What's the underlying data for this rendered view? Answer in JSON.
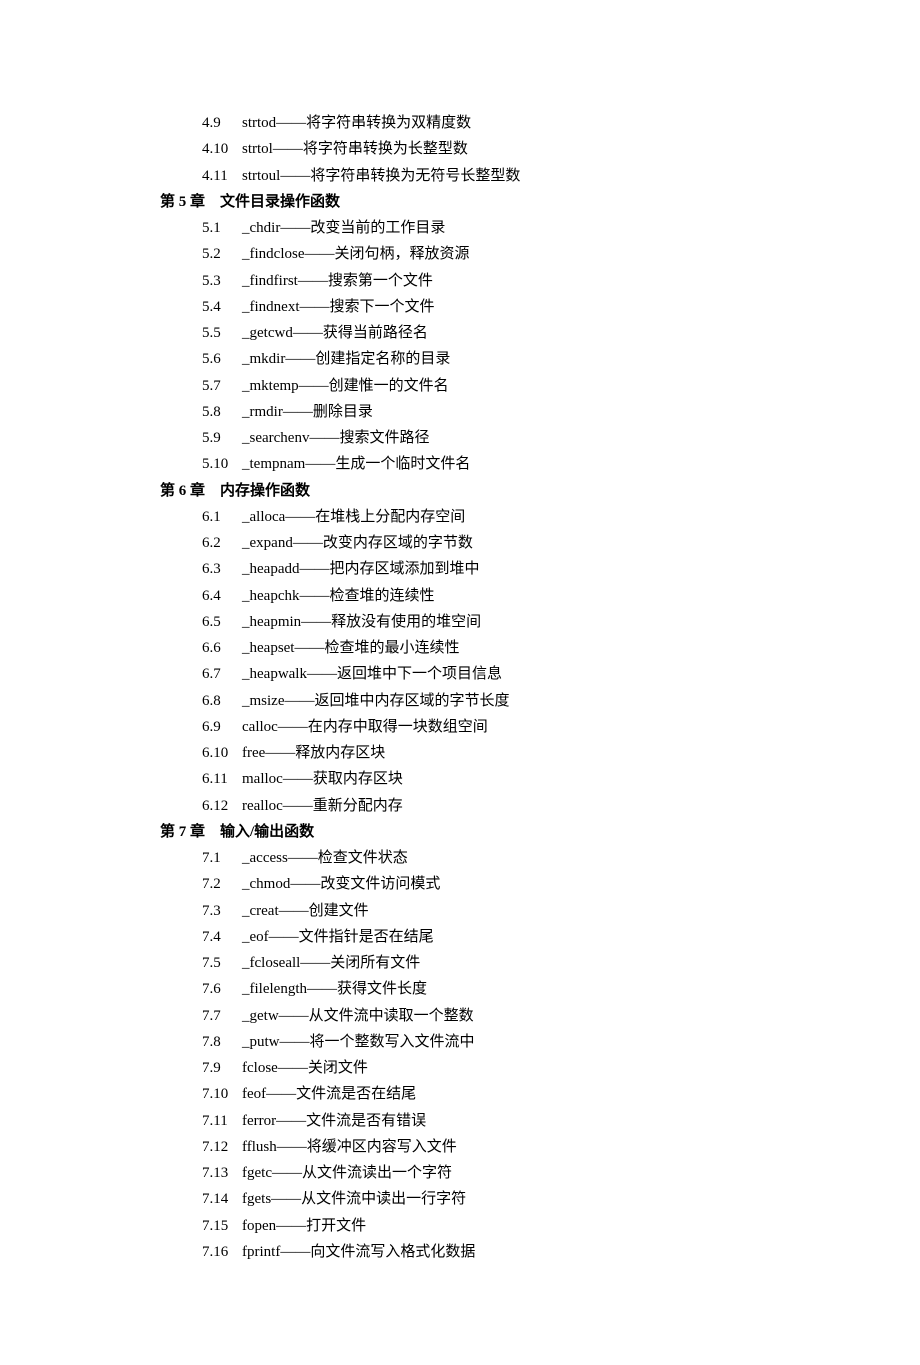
{
  "sections": [
    {
      "heading": null,
      "items": [
        {
          "num": "4.9",
          "text": "strtod——将字符串转换为双精度数"
        },
        {
          "num": "4.10",
          "text": "strtol——将字符串转换为长整型数"
        },
        {
          "num": "4.11",
          "text": "strtoul——将字符串转换为无符号长整型数"
        }
      ]
    },
    {
      "heading": "第 5 章　文件目录操作函数",
      "items": [
        {
          "num": "5.1",
          "text": "_chdir——改变当前的工作目录"
        },
        {
          "num": "5.2",
          "text": "_findclose——关闭句柄，释放资源"
        },
        {
          "num": "5.3",
          "text": "_findfirst——搜索第一个文件"
        },
        {
          "num": "5.4",
          "text": "_findnext——搜索下一个文件"
        },
        {
          "num": "5.5",
          "text": "_getcwd——获得当前路径名"
        },
        {
          "num": "5.6",
          "text": "_mkdir——创建指定名称的目录"
        },
        {
          "num": "5.7",
          "text": "_mktemp——创建惟一的文件名"
        },
        {
          "num": "5.8",
          "text": "_rmdir——删除目录"
        },
        {
          "num": "5.9",
          "text": "_searchenv——搜索文件路径"
        },
        {
          "num": "5.10",
          "text": "_tempnam——生成一个临时文件名"
        }
      ]
    },
    {
      "heading": "第 6 章　内存操作函数",
      "items": [
        {
          "num": "6.1",
          "text": "_alloca——在堆栈上分配内存空间"
        },
        {
          "num": "6.2",
          "text": "_expand——改变内存区域的字节数"
        },
        {
          "num": "6.3",
          "text": "_heapadd——把内存区域添加到堆中"
        },
        {
          "num": "6.4",
          "text": "_heapchk——检查堆的连续性"
        },
        {
          "num": "6.5",
          "text": "_heapmin——释放没有使用的堆空间"
        },
        {
          "num": "6.6",
          "text": "_heapset——检查堆的最小连续性"
        },
        {
          "num": "6.7",
          "text": "_heapwalk——返回堆中下一个项目信息"
        },
        {
          "num": "6.8",
          "text": "_msize——返回堆中内存区域的字节长度"
        },
        {
          "num": "6.9",
          "text": "calloc——在内存中取得一块数组空间"
        },
        {
          "num": "6.10",
          "text": "free——释放内存区块"
        },
        {
          "num": "6.11",
          "text": "malloc——获取内存区块"
        },
        {
          "num": "6.12",
          "text": "realloc——重新分配内存"
        }
      ]
    },
    {
      "heading": "第 7 章　输入/输出函数",
      "items": [
        {
          "num": "7.1",
          "text": "_access——检查文件状态"
        },
        {
          "num": "7.2",
          "text": "_chmod——改变文件访问模式"
        },
        {
          "num": "7.3",
          "text": "_creat——创建文件"
        },
        {
          "num": "7.4",
          "text": "_eof——文件指针是否在结尾"
        },
        {
          "num": "7.5",
          "text": "_fcloseall——关闭所有文件"
        },
        {
          "num": "7.6",
          "text": "_filelength——获得文件长度"
        },
        {
          "num": "7.7",
          "text": "_getw——从文件流中读取一个整数"
        },
        {
          "num": "7.8",
          "text": "_putw——将一个整数写入文件流中"
        },
        {
          "num": "7.9",
          "text": "fclose——关闭文件"
        },
        {
          "num": "7.10",
          "text": "feof——文件流是否在结尾"
        },
        {
          "num": "7.11",
          "text": "ferror——文件流是否有错误"
        },
        {
          "num": "7.12",
          "text": "fflush——将缓冲区内容写入文件"
        },
        {
          "num": "7.13",
          "text": "fgetc——从文件流读出一个字符"
        },
        {
          "num": "7.14",
          "text": "fgets——从文件流中读出一行字符"
        },
        {
          "num": "7.15",
          "text": "fopen——打开文件"
        },
        {
          "num": "7.16",
          "text": "fprintf——向文件流写入格式化数据"
        }
      ]
    }
  ]
}
